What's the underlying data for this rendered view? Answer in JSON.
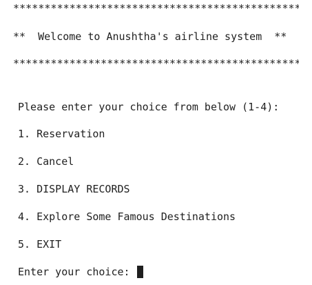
{
  "console": {
    "top_border": "*************************************************",
    "welcome_text": "**  Welcome to Anushtha's airline system  **",
    "bottom_border": "*************************************************",
    "prompt": "Please enter your choice from below (1-4):",
    "options": [
      "1. Reservation",
      "2. Cancel",
      "3. DISPLAY RECORDS",
      "4. Explore Some Famous Destinations",
      "5. EXIT"
    ],
    "input_prompt": "Enter your choice: ",
    "input_value": ""
  }
}
